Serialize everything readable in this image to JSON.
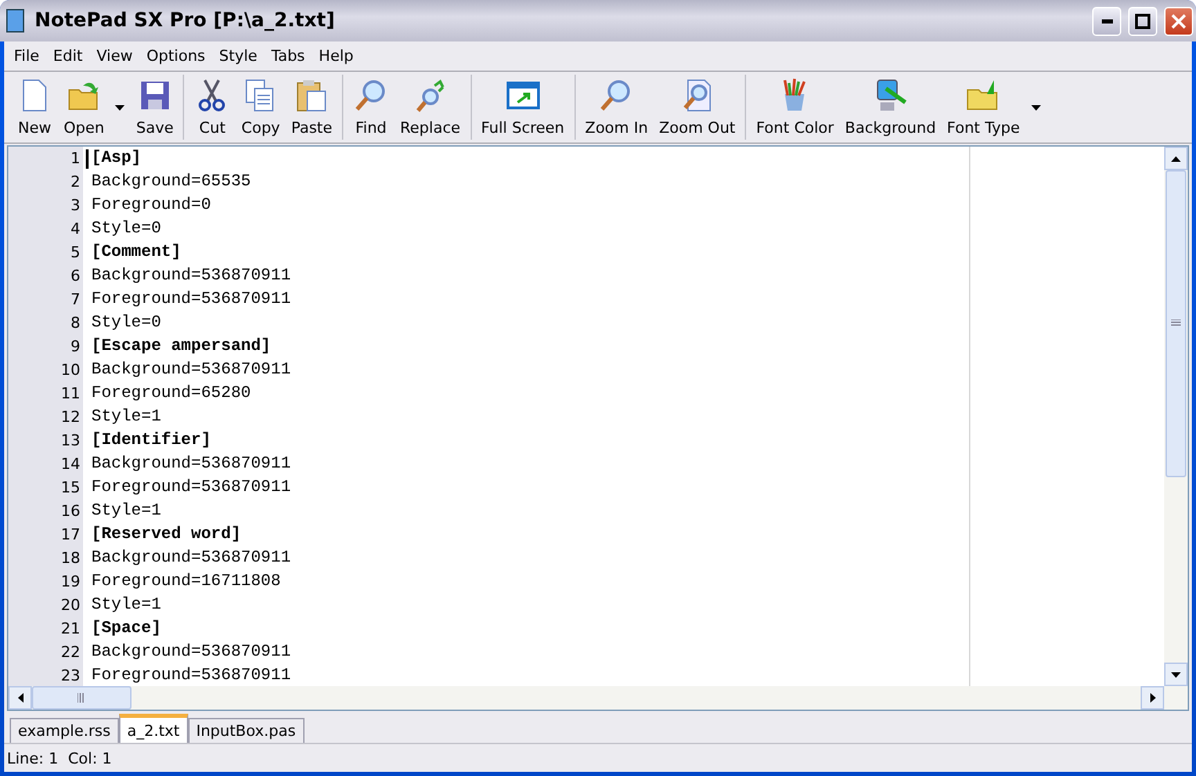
{
  "window": {
    "title": "NotePad SX Pro [P:\\a_2.txt]"
  },
  "menu": [
    "File",
    "Edit",
    "View",
    "Options",
    "Style",
    "Tabs",
    "Help"
  ],
  "toolbar": [
    [
      {
        "label": "New",
        "dropdown": false
      },
      {
        "label": "Open",
        "dropdown": true
      },
      {
        "label": "Save",
        "dropdown": false
      }
    ],
    [
      {
        "label": "Cut",
        "dropdown": false
      },
      {
        "label": "Copy",
        "dropdown": false
      },
      {
        "label": "Paste",
        "dropdown": false
      }
    ],
    [
      {
        "label": "Find",
        "dropdown": false
      },
      {
        "label": "Replace",
        "dropdown": false
      }
    ],
    [
      {
        "label": "Full Screen",
        "dropdown": false
      }
    ],
    [
      {
        "label": "Zoom In",
        "dropdown": false
      },
      {
        "label": "Zoom Out",
        "dropdown": false
      }
    ],
    [
      {
        "label": "Font Color",
        "dropdown": false
      },
      {
        "label": "Background",
        "dropdown": false
      },
      {
        "label": "Font Type",
        "dropdown": true
      }
    ]
  ],
  "editor": {
    "lines": [
      {
        "number": "1",
        "text": "[Asp]",
        "kind": "section"
      },
      {
        "number": "2",
        "text": "Background=65535",
        "kind": "entry"
      },
      {
        "number": "3",
        "text": "Foreground=0",
        "kind": "entry"
      },
      {
        "number": "4",
        "text": "Style=0",
        "kind": "entry"
      },
      {
        "number": "5",
        "text": "[Comment]",
        "kind": "section"
      },
      {
        "number": "6",
        "text": "Background=536870911",
        "kind": "entry"
      },
      {
        "number": "7",
        "text": "Foreground=536870911",
        "kind": "entry"
      },
      {
        "number": "8",
        "text": "Style=0",
        "kind": "entry"
      },
      {
        "number": "9",
        "text": "[Escape ampersand]",
        "kind": "section"
      },
      {
        "number": "10",
        "text": "Background=536870911",
        "kind": "entry"
      },
      {
        "number": "11",
        "text": "Foreground=65280",
        "kind": "entry"
      },
      {
        "number": "12",
        "text": "Style=1",
        "kind": "entry"
      },
      {
        "number": "13",
        "text": "[Identifier]",
        "kind": "section"
      },
      {
        "number": "14",
        "text": "Background=536870911",
        "kind": "entry"
      },
      {
        "number": "15",
        "text": "Foreground=536870911",
        "kind": "entry"
      },
      {
        "number": "16",
        "text": "Style=1",
        "kind": "entry"
      },
      {
        "number": "17",
        "text": "[Reserved word]",
        "kind": "section"
      },
      {
        "number": "18",
        "text": "Background=536870911",
        "kind": "entry"
      },
      {
        "number": "19",
        "text": "Foreground=16711808",
        "kind": "entry"
      },
      {
        "number": "20",
        "text": "Style=1",
        "kind": "entry"
      },
      {
        "number": "21",
        "text": "[Space]",
        "kind": "section"
      },
      {
        "number": "22",
        "text": "Background=536870911",
        "kind": "entry"
      },
      {
        "number": "23",
        "text": "Foreground=536870911",
        "kind": "entry"
      }
    ]
  },
  "tabs": [
    {
      "label": "example.rss",
      "selected": false
    },
    {
      "label": "a_2.txt",
      "selected": true
    },
    {
      "label": "InputBox.pas",
      "selected": false
    }
  ],
  "status_bar": {
    "position": "Line: 1  Col: 1"
  }
}
